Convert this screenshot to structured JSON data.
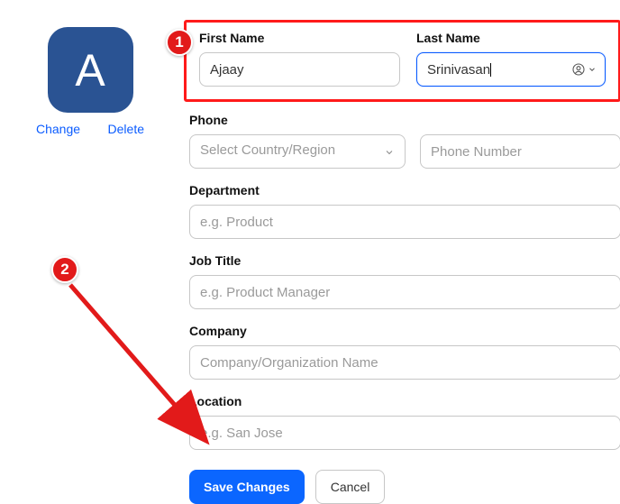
{
  "avatar": {
    "letter": "A",
    "change": "Change",
    "delete": "Delete"
  },
  "annotations": {
    "badge1": "1",
    "badge2": "2"
  },
  "labels": {
    "first_name": "First Name",
    "last_name": "Last Name",
    "phone": "Phone",
    "department": "Department",
    "job_title": "Job Title",
    "company": "Company",
    "location": "Location"
  },
  "values": {
    "first_name": "Ajaay",
    "last_name": "Srinivasan"
  },
  "placeholders": {
    "country": "Select Country/Region",
    "phone_number": "Phone Number",
    "department": "e.g. Product",
    "job_title": "e.g. Product Manager",
    "company": "Company/Organization Name",
    "location": "e.g. San Jose"
  },
  "buttons": {
    "save": "Save Changes",
    "cancel": "Cancel"
  }
}
